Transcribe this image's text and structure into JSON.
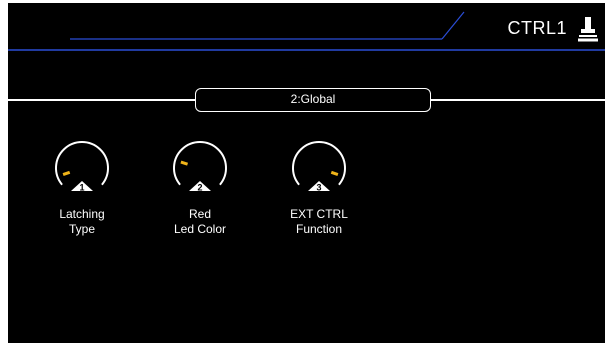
{
  "header": {
    "ctrl_label": "CTRL1",
    "accent_color": "#2a4dd6",
    "icon": "footswitch-icon"
  },
  "page": {
    "title": "2:Global"
  },
  "knobs": [
    {
      "number": "1",
      "label_line1": "Latching",
      "label_line2": "Type",
      "value_fraction": 0.08,
      "indicator_color": "#f0b419"
    },
    {
      "number": "2",
      "label_line1": "Red",
      "label_line2": "Led Color",
      "value_fraction": 0.22,
      "indicator_color": "#f0b419"
    },
    {
      "number": "3",
      "label_line1": "EXT CTRL",
      "label_line2": "Function",
      "value_fraction": 0.92,
      "indicator_color": "#f0b419"
    }
  ]
}
